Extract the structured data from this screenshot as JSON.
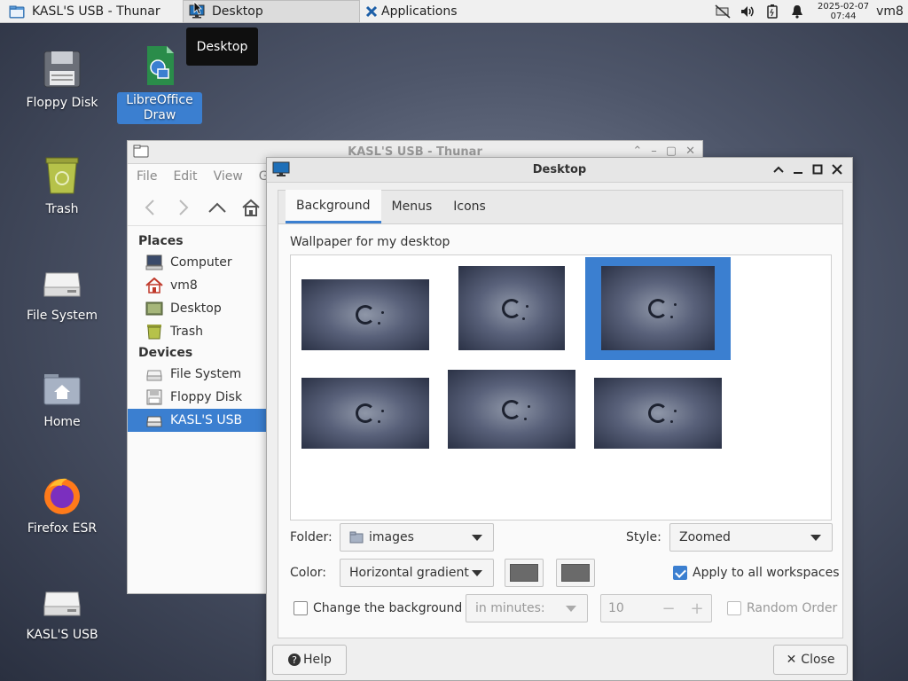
{
  "taskbar": {
    "tasks": [
      {
        "label": "KASL'S USB - Thunar"
      },
      {
        "label": "Desktop"
      },
      {
        "label": "Applications"
      }
    ],
    "clock_date": "2025-02-07",
    "clock_time": "07:44",
    "user": "vm8"
  },
  "tooltip": "Desktop",
  "desktop_icons": [
    {
      "label": "Floppy Disk"
    },
    {
      "label": "LibreOffice Draw"
    },
    {
      "label": "Trash"
    },
    {
      "label": "File System"
    },
    {
      "label": "Home"
    },
    {
      "label": "Firefox ESR"
    },
    {
      "label": "KASL'S USB"
    }
  ],
  "thunar": {
    "title": "KASL'S USB - Thunar",
    "menu": [
      "File",
      "Edit",
      "View",
      "Go"
    ],
    "places_header": "Places",
    "places": [
      "Computer",
      "vm8",
      "Desktop",
      "Trash"
    ],
    "devices_header": "Devices",
    "devices": [
      "File System",
      "Floppy Disk",
      "KASL'S USB"
    ]
  },
  "dialog": {
    "title": "Desktop",
    "tabs": [
      "Background",
      "Menus",
      "Icons"
    ],
    "active_tab": "Background",
    "wallpaper_label": "Wallpaper for my desktop",
    "wallpaper_count": 6,
    "selected_wallpaper_index": 2,
    "folder_label": "Folder:",
    "folder_value": "images",
    "style_label": "Style:",
    "style_value": "Zoomed",
    "color_label": "Color:",
    "color_value": "Horizontal gradient",
    "color1": "#6a6a6a",
    "color2": "#6a6a6a",
    "apply_all_label": "Apply to all workspaces",
    "apply_all_checked": true,
    "change_bg_label": "Change the background",
    "change_bg_checked": false,
    "interval_unit": "in minutes:",
    "interval_value": "10",
    "random_order_label": "Random Order",
    "random_order_checked": false,
    "help_label": "Help",
    "close_label": "Close"
  },
  "colors": {
    "accent": "#3b7fd0"
  }
}
